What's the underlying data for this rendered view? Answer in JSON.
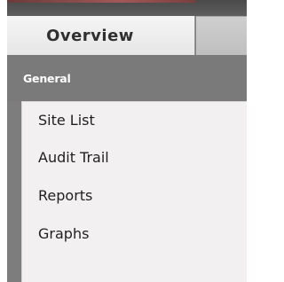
{
  "tabs": {
    "active_label": "Overview",
    "inactive_label": ""
  },
  "section": {
    "title": "General"
  },
  "nav": {
    "items": [
      {
        "label": "Site List"
      },
      {
        "label": "Audit Trail"
      },
      {
        "label": "Reports"
      },
      {
        "label": "Graphs"
      }
    ]
  },
  "colors": {
    "frame": "#7d7d7d",
    "active_tab": "#eeeeee",
    "list_background": "#f3f0f1",
    "header_text": "#ffffff",
    "accent": "#a25757"
  }
}
